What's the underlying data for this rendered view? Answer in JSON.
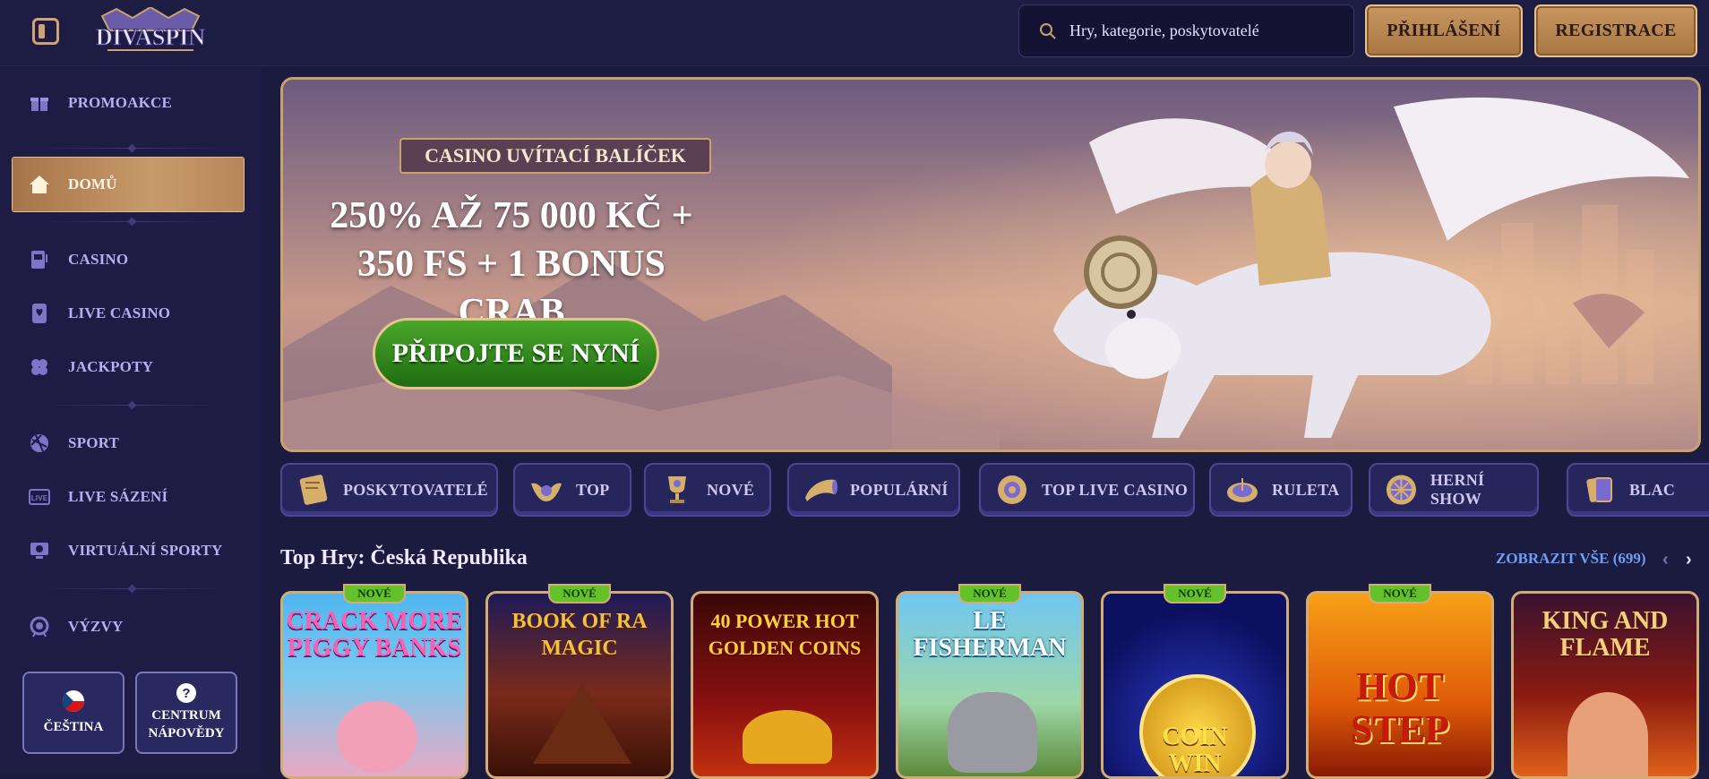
{
  "header": {
    "logo_text": "DIVASPIN",
    "search_placeholder": "Hry, kategorie, poskytovatelé",
    "login_label": "PŘIHLÁŠENÍ",
    "register_label": "REGISTRACE"
  },
  "sidebar": {
    "items": [
      {
        "label": "PROMOAKCE",
        "icon": "gift-icon"
      },
      {
        "label": "DOMŮ",
        "icon": "home-icon",
        "active": true
      },
      {
        "label": "CASINO",
        "icon": "slot-machine-icon"
      },
      {
        "label": "LIVE CASINO",
        "icon": "card-icon"
      },
      {
        "label": "JACKPOTY",
        "icon": "clover-icon"
      },
      {
        "label": "SPORT",
        "icon": "ball-icon"
      },
      {
        "label": "LIVE SÁZENÍ",
        "icon": "live-icon"
      },
      {
        "label": "VIRTUÁLNÍ SPORTY",
        "icon": "virtual-sports-icon"
      },
      {
        "label": "VÝZVY",
        "icon": "medal-icon"
      }
    ],
    "language_label": "ČEŠTINA",
    "help_label": "CENTRUM\nNÁPOVĚDY"
  },
  "banner": {
    "pill": "CASINO UVÍTACÍ BALÍČEK",
    "headline": "250% AŽ 75 000 KČ +\n350 FS + 1 BONUS CRAB",
    "cta": "PŘIPOJTE SE NYNÍ"
  },
  "categories": [
    "POSKYTOVATELÉ",
    "TOP",
    "NOVÉ",
    "POPULÁRNÍ",
    "TOP LIVE CASINO",
    "RULETA",
    "HERNÍ SHOW",
    "BLAC"
  ],
  "games_section": {
    "title": "Top Hry: Česká Republika",
    "view_all": "ZOBRAZIT VŠE (699)",
    "badge": "NOVÉ",
    "games": [
      {
        "title": "CRACK MORE\nPIGGY BANKS",
        "new": true
      },
      {
        "title": "BOOK OF RA\nMAGIC",
        "new": true
      },
      {
        "title": "40 POWER HOT\nGOLDEN COINS",
        "new": false
      },
      {
        "title": "LE\nFISHERMAN",
        "new": true
      },
      {
        "title": "COIN\nWIN",
        "new": true
      },
      {
        "title": "HOT\nSTEP",
        "new": true
      },
      {
        "title": "KING AND\nFLAME",
        "new": false
      }
    ]
  },
  "colors": {
    "accent_gold": "#c9a16b",
    "bg": "#1b1a3f",
    "link": "#6f9ff5",
    "badge_green": "#63c12c"
  }
}
